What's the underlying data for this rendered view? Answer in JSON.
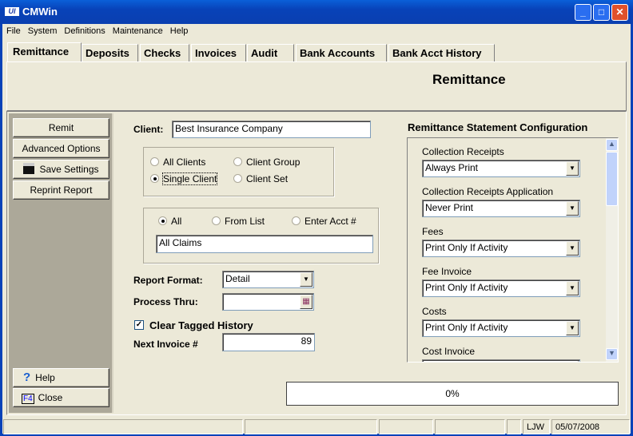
{
  "window": {
    "title": "CMWin",
    "minimize": "_",
    "maximize": "□",
    "close": "✕"
  },
  "menu": [
    "File",
    "System",
    "Definitions",
    "Maintenance",
    "Help"
  ],
  "tabs": [
    "Remittance",
    "Deposits",
    "Checks",
    "Invoices",
    "Audit",
    "Bank Accounts",
    "Bank Acct History"
  ],
  "header": {
    "title": "Remittance"
  },
  "sidebar": {
    "remit": "Remit",
    "advanced": "Advanced Options",
    "save": "Save Settings",
    "reprint": "Reprint Report",
    "help": "Help",
    "close": "Close",
    "f4": "F4"
  },
  "form": {
    "client_label": "Client:",
    "client_value": "Best Insurance Company",
    "client_scope": {
      "all_clients": "All Clients",
      "client_group": "Client Group",
      "single_client": "Single Client",
      "client_set": "Client Set",
      "selected": "Single Client"
    },
    "claims": {
      "all": "All",
      "from_list": "From List",
      "enter_acct": "Enter Acct #",
      "selected": "All",
      "value": "All Claims"
    },
    "report_format_label": "Report Format:",
    "report_format_value": "Detail",
    "process_thru_label": "Process Thru:",
    "process_thru_value": "",
    "clear_tagged_label": "Clear Tagged History",
    "clear_tagged_checked": true,
    "next_invoice_label": "Next Invoice #",
    "next_invoice_value": "89"
  },
  "config": {
    "title": "Remittance Statement Configuration",
    "items": [
      {
        "label": "Collection Receipts",
        "value": "Always Print"
      },
      {
        "label": "Collection Receipts Application",
        "value": "Never Print"
      },
      {
        "label": "Fees",
        "value": "Print Only If Activity"
      },
      {
        "label": "Fee Invoice",
        "value": "Print Only If Activity"
      },
      {
        "label": "Costs",
        "value": "Print Only If Activity"
      },
      {
        "label": "Cost Invoice",
        "value": ""
      }
    ]
  },
  "progress": {
    "text": "0%",
    "value": 0
  },
  "status": {
    "user": "LJW",
    "date": "05/07/2008"
  }
}
